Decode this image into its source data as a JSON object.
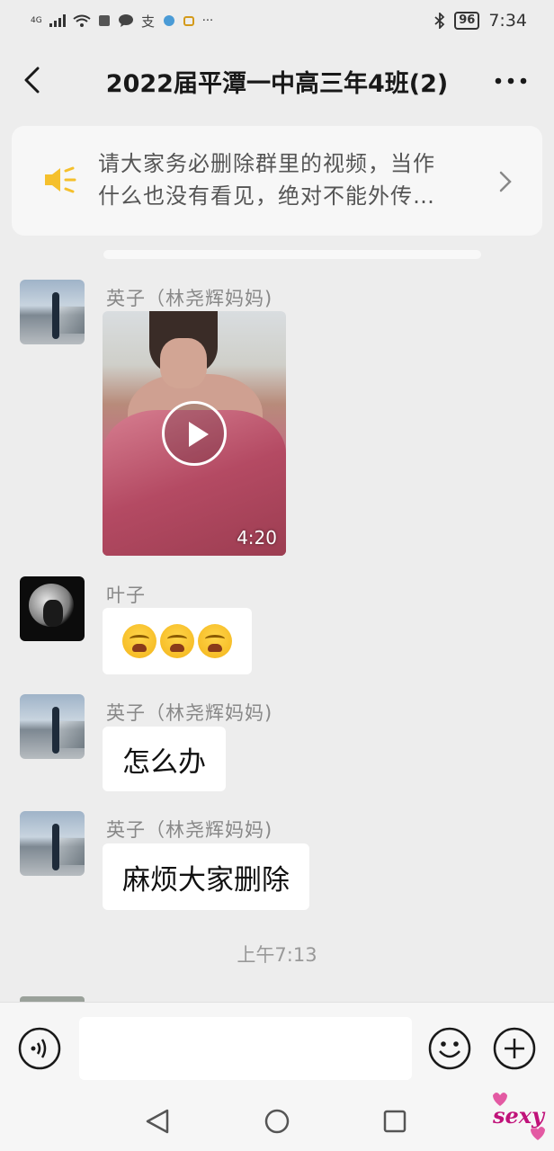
{
  "status_bar": {
    "signal": "4G",
    "battery": "96",
    "time": "7:34"
  },
  "header": {
    "title": "2022届平潭一中高三年4班(2)"
  },
  "announcement": {
    "line1": "请大家务必删除群里的视频，当作",
    "line2": "什么也没有看见，绝对不能外传…"
  },
  "messages": [
    {
      "sender": "英子（林尧辉妈妈)",
      "type": "video",
      "duration": "4:20"
    },
    {
      "sender": "叶子",
      "type": "emoji",
      "emoji_count": 3,
      "emoji_name": "crying-laughing-emoji"
    },
    {
      "sender": "英子（林尧辉妈妈)",
      "type": "text",
      "text": "怎么办"
    },
    {
      "sender": "英子（林尧辉妈妈)",
      "type": "text",
      "text": "麻烦大家删除"
    }
  ],
  "timestamp": "上午7:13",
  "input": {
    "value": "",
    "placeholder": ""
  },
  "watermark": "sexy",
  "colors": {
    "background": "#ededed",
    "bubble": "#ffffff",
    "speaker_accent": "#f5c02c",
    "watermark": "#c0137a"
  }
}
